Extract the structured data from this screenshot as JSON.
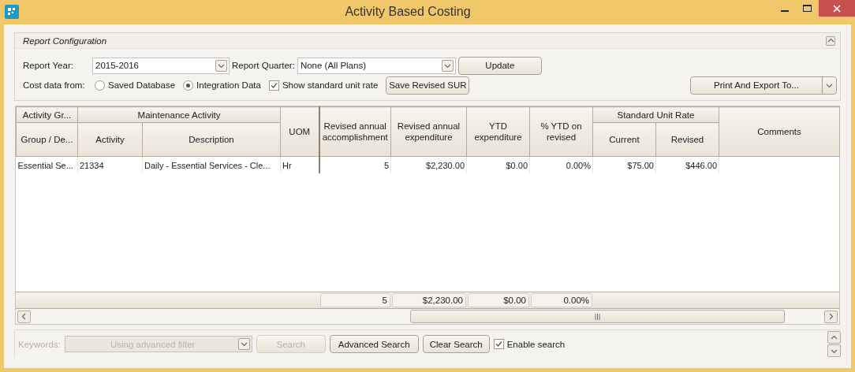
{
  "window": {
    "title": "Activity Based Costing"
  },
  "report_configuration": {
    "title": "Report Configuration",
    "report_year": {
      "label": "Report Year:",
      "value": "2015-2016"
    },
    "report_quarter": {
      "label": "Report Quarter:",
      "value": "None (All Plans)"
    },
    "cost_data_from": {
      "label": "Cost data from:",
      "options": [
        {
          "label": "Saved Database",
          "selected": false
        },
        {
          "label": "Integration Data",
          "selected": true
        }
      ]
    },
    "show_standard_unit_rate": {
      "label": "Show standard unit rate",
      "checked": true
    },
    "buttons": {
      "update": "Update",
      "save": "Save Revised SUR",
      "print": "Print And Export To..."
    }
  },
  "table": {
    "headers": [
      {
        "label": "Activity Gr...",
        "children": [
          "Group / De..."
        ]
      },
      {
        "label": "Maintenance Activity",
        "children": [
          "Activity",
          "Description"
        ]
      },
      {
        "label": "UOM"
      },
      {
        "label": "Revised annual accomplishment"
      },
      {
        "label": "Revised annual expenditure"
      },
      {
        "label": "YTD expenditure"
      },
      {
        "label": "% YTD on revised"
      },
      {
        "label": "Standard Unit Rate",
        "children": [
          "Current",
          "Revised"
        ]
      },
      {
        "label": "Comments"
      }
    ],
    "rows": [
      {
        "cells": [
          "Essential Se...",
          "21334",
          "Daily - Essential Services - Cle...",
          "Hr",
          "5",
          "$2,230.00",
          "$0.00",
          "0.00%",
          "$75.00",
          "$446.00"
        ]
      }
    ],
    "totals": [
      "5",
      "$2,230.00",
      "$0.00",
      "0.00%"
    ]
  },
  "search": {
    "label": "Keywords:",
    "placeholder": "Using advanced filter",
    "disabled": true,
    "search_button": "Search",
    "advanced_search": "Advanced Search",
    "clear_search": "Clear Search",
    "enable_search": {
      "label": "Enable search",
      "checked": true
    }
  }
}
